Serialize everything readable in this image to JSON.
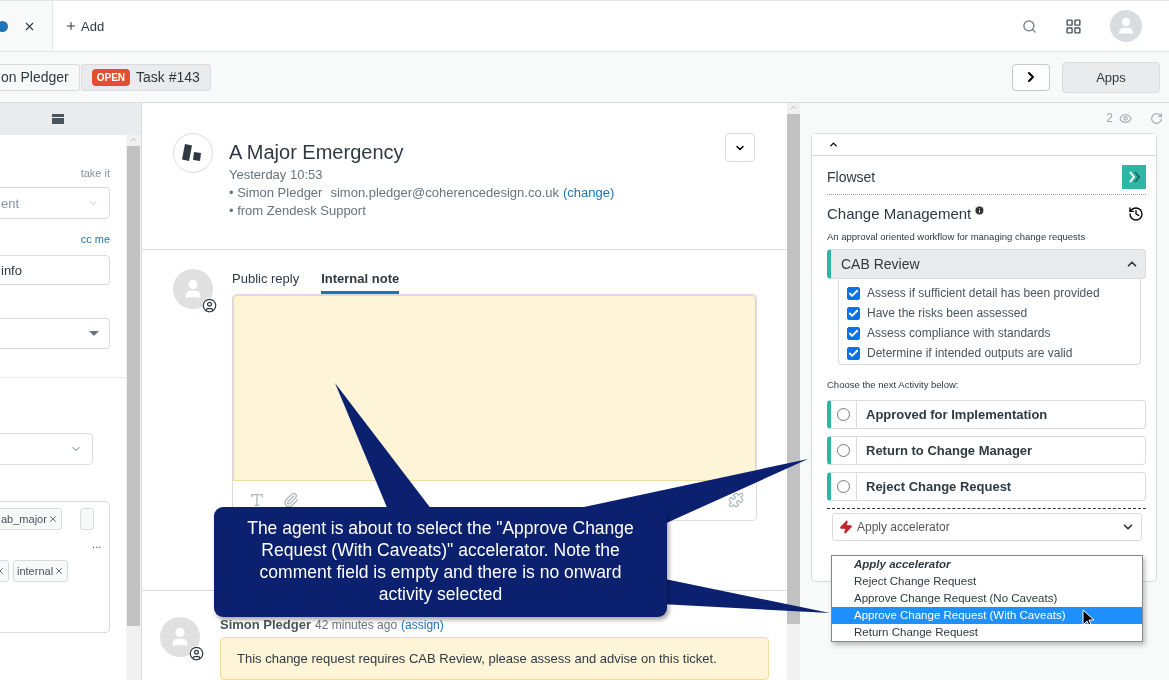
{
  "top_bar": {
    "add_label": "Add"
  },
  "ticket_bar": {
    "crumbs": [
      {
        "label": "on Pledger"
      },
      {
        "label": "Task #143",
        "badge": "OPEN"
      }
    ],
    "apps_label": "Apps"
  },
  "left_panel": {
    "take_it": "take it",
    "assignee_value": "ent",
    "cc_me": "cc me",
    "field_value": "info",
    "tags": [
      "ab_major",
      "internal"
    ],
    "more": "..."
  },
  "ticket": {
    "title": "A Major Emergency",
    "time": "Yesterday 10:53",
    "requester": "• Simon Pledger",
    "email": "simon.pledger@coherencedesign.co.uk",
    "change_link": "(change)",
    "source": "• from Zendesk Support"
  },
  "reply_tabs": [
    {
      "label": "Public reply",
      "selected": false
    },
    {
      "label": "Internal note",
      "selected": true
    }
  ],
  "comment": {
    "author": "Simon Pledger",
    "time": "42 minutes ago",
    "link": "(assign)",
    "body": "This change request requires CAB Review, please assess and advise on this ticket."
  },
  "app": {
    "viewers": "2",
    "name": "Flowset",
    "workflow": "Change Management",
    "description": "An approval oriented workflow for managing change requests",
    "stage": {
      "label": "CAB Review",
      "expanded": true,
      "checklist": [
        {
          "label": "Assess if sufficient detail has been provided",
          "checked": true
        },
        {
          "label": "Have the risks been assessed",
          "checked": true
        },
        {
          "label": "Assess compliance with standards",
          "checked": true
        },
        {
          "label": "Determine if intended outputs are valid",
          "checked": true
        }
      ]
    },
    "prompt": "Choose the next Activity below:",
    "activities": [
      {
        "label": "Approved for Implementation",
        "selected": false
      },
      {
        "label": "Return to Change Manager",
        "selected": false
      },
      {
        "label": "Reject Change Request",
        "selected": false
      }
    ],
    "accelerator": {
      "placeholder": "Apply accelerator",
      "options": [
        {
          "label": "Apply accelerator",
          "kind": "header",
          "selected": false
        },
        {
          "label": "Reject Change Request",
          "kind": "option",
          "selected": false
        },
        {
          "label": "Approve Change Request (No Caveats)",
          "kind": "option",
          "selected": false
        },
        {
          "label": "Approve Change Request (With Caveats)",
          "kind": "option",
          "selected": true
        },
        {
          "label": "Return Change Request",
          "kind": "option",
          "selected": false
        }
      ]
    }
  },
  "callout": {
    "text": "The agent is about to select the \"Approve Change Request (With Caveats)\" accelerator. Note the comment field is empty and there is no onward activity selected"
  }
}
